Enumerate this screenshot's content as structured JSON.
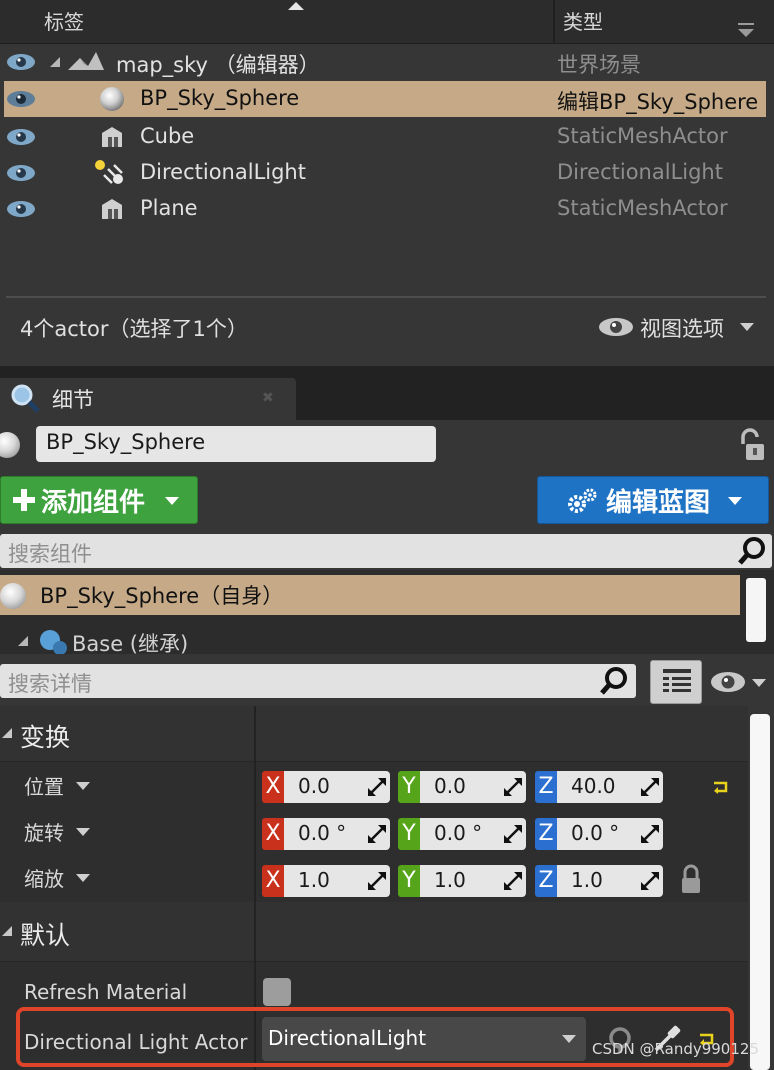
{
  "outliner": {
    "header": {
      "label_col": "标签",
      "type_col": "类型"
    },
    "rows": [
      {
        "name": "map_sky （编辑器）",
        "type": "世界场景"
      },
      {
        "name": "BP_Sky_Sphere",
        "type": "编辑BP_Sky_Sphere"
      },
      {
        "name": "Cube",
        "type": "StaticMeshActor"
      },
      {
        "name": "DirectionalLight",
        "type": "DirectionalLight"
      },
      {
        "name": "Plane",
        "type": "StaticMeshActor"
      }
    ],
    "actor_count": "4个actor（选择了1个）",
    "view_options": "视图选项"
  },
  "details": {
    "tab_label": "细节",
    "actor_name": "BP_Sky_Sphere",
    "add_component": "添加组件",
    "edit_blueprint": "编辑蓝图",
    "search_components_placeholder": "搜索组件",
    "component_self": "BP_Sky_Sphere（自身）",
    "component_base": "Base (继承)",
    "search_details_placeholder": "搜索详情",
    "categories": {
      "transform": "变换",
      "default": "默认"
    },
    "transform": {
      "location": {
        "label": "位置",
        "x": "0.0",
        "y": "0.0",
        "z": "40.0"
      },
      "rotation": {
        "label": "旋转",
        "x": "0.0 °",
        "y": "0.0 °",
        "z": "0.0 °"
      },
      "scale": {
        "label": "缩放",
        "x": "1.0",
        "y": "1.0",
        "z": "1.0"
      }
    },
    "axis_labels": {
      "x": "X",
      "y": "Y",
      "z": "Z"
    },
    "refresh_material": {
      "label": "Refresh Material"
    },
    "directional_light_actor": {
      "label": "Directional Light Actor",
      "value": "DirectionalLight"
    }
  },
  "watermark": "CSDN @Randy990125",
  "colors": {
    "selection": "#c6aa88",
    "add_button": "#3ea23e",
    "blueprint_button": "#1f73c4",
    "highlight": "#e0452a"
  }
}
